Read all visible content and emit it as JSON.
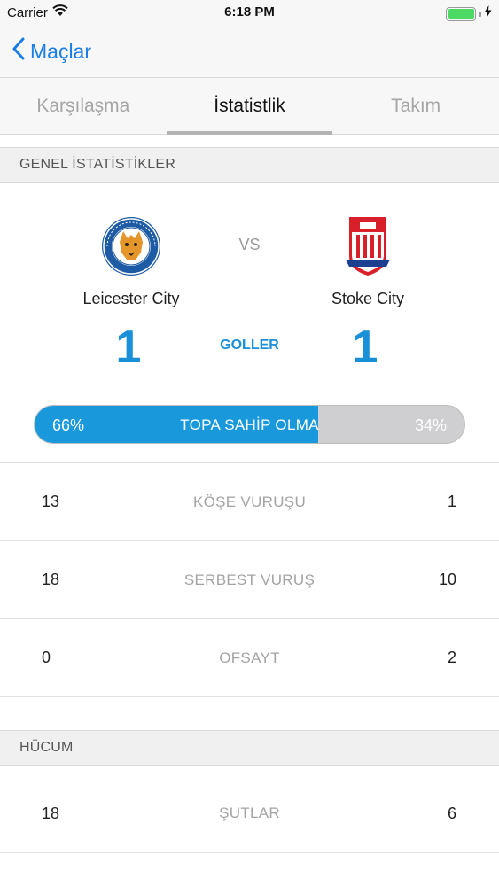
{
  "status_bar": {
    "carrier": "Carrier",
    "time": "6:18 PM"
  },
  "nav": {
    "back_label": "Maçlar"
  },
  "tabs": [
    {
      "label": "Karşılaşma",
      "active": false
    },
    {
      "label": "İstatistlik",
      "active": true
    },
    {
      "label": "Takım",
      "active": false
    }
  ],
  "sections": {
    "general": "GENEL İSTATİSTİKLER",
    "attack": "HÜCUM"
  },
  "match": {
    "home_team": "Leicester City",
    "away_team": "Stoke City",
    "vs": "VS",
    "home_score": "1",
    "away_score": "1",
    "goals_label": "GOLLER"
  },
  "possession": {
    "label": "TOPA SAHİP OLMA",
    "home": "66%",
    "away": "34%",
    "home_fraction": 0.66
  },
  "general_stats": [
    {
      "label": "KÖŞE VURUŞU",
      "home": "13",
      "away": "1"
    },
    {
      "label": "SERBEST VURUŞ",
      "home": "18",
      "away": "10"
    },
    {
      "label": "OFSAYT",
      "home": "0",
      "away": "2"
    }
  ],
  "attack_stats": [
    {
      "label": "ŞUTLAR",
      "home": "18",
      "away": "6"
    }
  ],
  "colors": {
    "accent": "#1a90d8",
    "ios_blue": "#1a7ee6",
    "possession_home": "#1a98dc",
    "possession_away": "#cfcfd1"
  },
  "icons": {
    "home_crest": "leicester-city-crest",
    "away_crest": "stoke-city-crest"
  }
}
